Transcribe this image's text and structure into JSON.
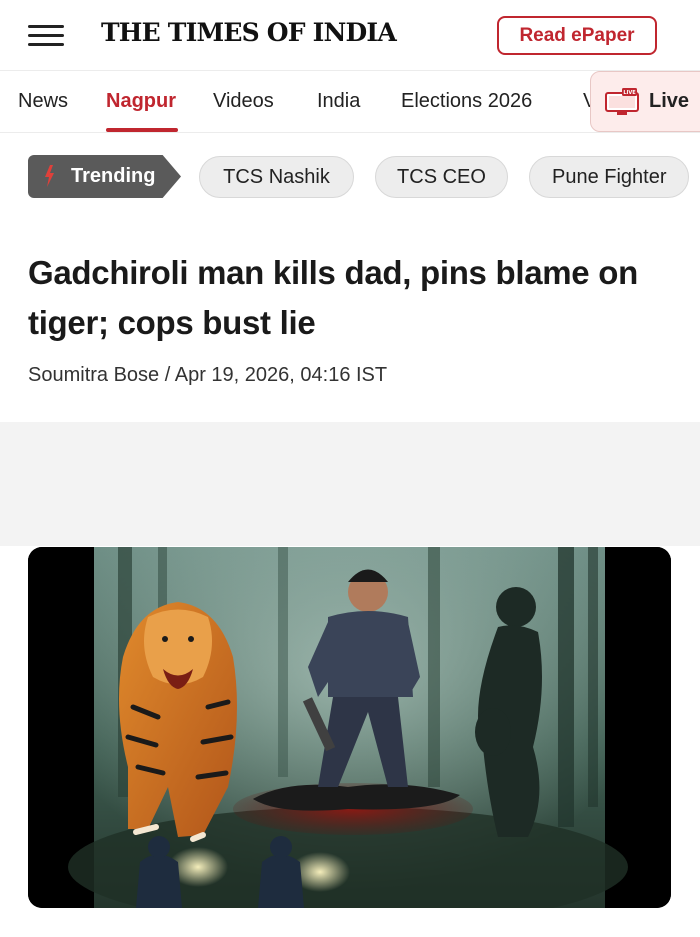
{
  "header": {
    "logo_text": "THE TIMES OF INDIA",
    "epaper_label": "Read ePaper"
  },
  "nav": {
    "items": [
      {
        "label": "News"
      },
      {
        "label": "Nagpur",
        "active": true
      },
      {
        "label": "Videos"
      },
      {
        "label": "India"
      },
      {
        "label": "Elections 2026"
      },
      {
        "label": "V"
      }
    ],
    "live_label": "Live",
    "live_badge": "LIVE"
  },
  "trending": {
    "badge_label": "Trending",
    "chips": [
      "TCS Nashik",
      "TCS CEO",
      "Pune Fighter"
    ]
  },
  "article": {
    "headline": "Gadchiroli man kills dad, pins blame on tiger; cops bust lie",
    "author": "Soumitra Bose",
    "date": "Apr 19, 2026, 04:16 IST"
  },
  "colors": {
    "brand_red": "#c0262f",
    "trending_bg": "#5a5a5a",
    "live_bg": "#fdeceb"
  },
  "icons": {
    "menu": "hamburger-menu-icon",
    "live": "live-tv-icon",
    "trending": "flame-icon"
  }
}
